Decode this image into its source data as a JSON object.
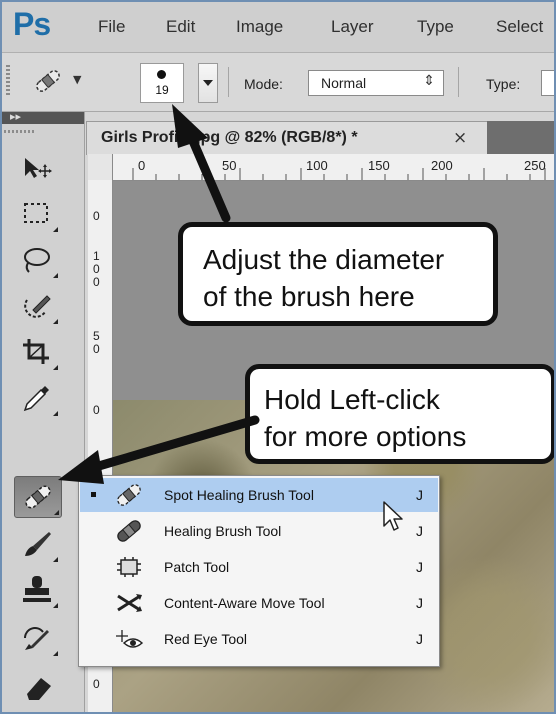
{
  "app": {
    "logo": "Ps"
  },
  "menubar": {
    "items": [
      "File",
      "Edit",
      "Image",
      "Layer",
      "Type",
      "Select"
    ]
  },
  "options_bar": {
    "brush_size": "19",
    "mode_label": "Mode:",
    "mode_value": "Normal",
    "type_label": "Type:"
  },
  "document": {
    "tab_title": "Girls Profile.jpg @ 82% (RGB/8*) *",
    "close_glyph": "×",
    "ruler_top": [
      "0",
      "50",
      "100",
      "150",
      "200",
      "250"
    ],
    "ruler_left": [
      "0",
      "1\n0\n0",
      "5\n0",
      "0",
      "0"
    ]
  },
  "callouts": {
    "diameter": [
      "Adjust the diameter",
      "of the brush here"
    ],
    "options": [
      "Hold Left-click",
      "for more options"
    ]
  },
  "tool_flyout": {
    "items": [
      {
        "label": "Spot Healing Brush Tool",
        "shortcut": "J",
        "icon": "spot-healing-brush-icon",
        "selected": true
      },
      {
        "label": "Healing Brush Tool",
        "shortcut": "J",
        "icon": "healing-brush-icon",
        "selected": false
      },
      {
        "label": "Patch Tool",
        "shortcut": "J",
        "icon": "patch-icon",
        "selected": false
      },
      {
        "label": "Content-Aware Move Tool",
        "shortcut": "J",
        "icon": "content-aware-move-icon",
        "selected": false
      },
      {
        "label": "Red Eye Tool",
        "shortcut": "J",
        "icon": "red-eye-icon",
        "selected": false
      }
    ]
  },
  "colors": {
    "ps_blue": "#1f6ea8",
    "selection_highlight": "#aecdf0",
    "frame_border": "#6f8fb3"
  }
}
